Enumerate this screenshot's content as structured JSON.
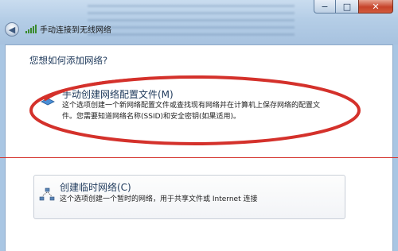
{
  "window": {
    "title": "手动连接到无线网络",
    "min_symbol": "−",
    "max_symbol": "□",
    "close_symbol": "✕",
    "back_symbol": "◀"
  },
  "page": {
    "question": "您想如何添加网络?"
  },
  "options": [
    {
      "title": "手动创建网络配置文件(M)",
      "desc_line1": "这个选项创建一个新网络配置文件或查找现有网络并在计算机上保存网络的配置文",
      "desc_line2": "件。您需要知道网络名称(SSID)和安全密钥(如果适用)。",
      "icon": "network-icon"
    },
    {
      "title": "创建临时网络(C)",
      "desc_line1": "这个选项创建一个暂时的网络，用于共享文件或 Internet 连接",
      "icon": "adhoc-network-icon"
    }
  ],
  "colors": {
    "annotation_red": "#d4312b",
    "heading_blue": "#1e395b"
  }
}
